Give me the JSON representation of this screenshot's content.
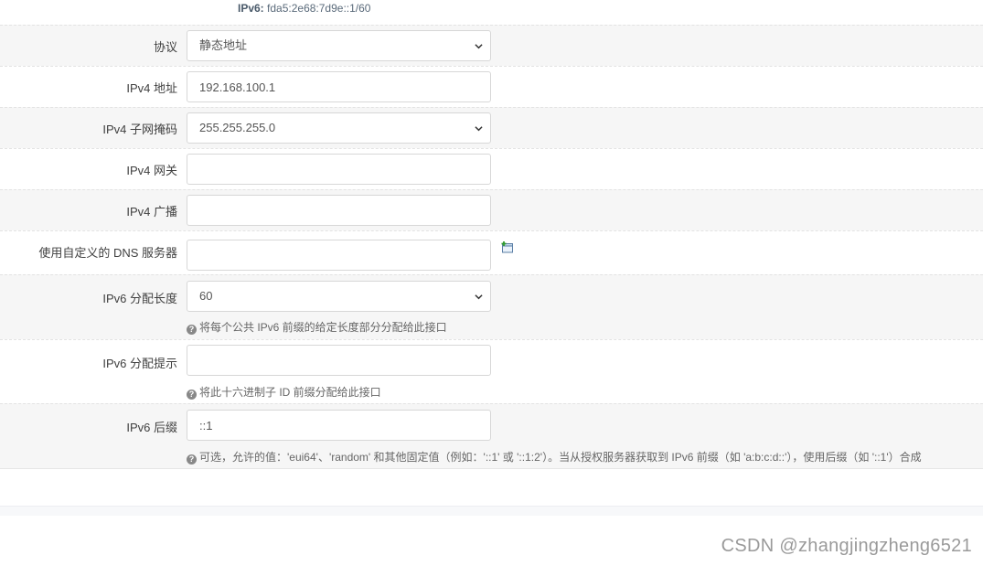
{
  "header": {
    "ipv6_label": "IPv6:",
    "ipv6_value": "fda5:2e68:7d9e::1/60"
  },
  "fields": {
    "protocol": {
      "label": "协议",
      "value": "静态地址"
    },
    "ipv4_address": {
      "label": "IPv4 地址",
      "value": "192.168.100.1"
    },
    "ipv4_netmask": {
      "label": "IPv4 子网掩码",
      "value": "255.255.255.0"
    },
    "ipv4_gateway": {
      "label": "IPv4 网关",
      "value": ""
    },
    "ipv4_broadcast": {
      "label": "IPv4 广播",
      "value": ""
    },
    "custom_dns": {
      "label": "使用自定义的 DNS 服务器",
      "value": ""
    },
    "ipv6_assign_length": {
      "label": "IPv6 分配长度",
      "value": "60",
      "hint": "将每个公共 IPv6 前缀的给定长度部分分配给此接口"
    },
    "ipv6_assign_hint": {
      "label": "IPv6 分配提示",
      "value": "",
      "hint": "将此十六进制子 ID 前缀分配给此接口"
    },
    "ipv6_suffix": {
      "label": "IPv6 后缀",
      "value": "::1",
      "hint": "可选，允许的值：'eui64'、'random' 和其他固定值（例如：'::1' 或 '::1:2'）。当从授权服务器获取到 IPv6 前缀（如 'a:b:c:d::'），使用后缀（如 '::1'）合成"
    }
  },
  "icons": {
    "add": "add-entry-icon",
    "help": "help-icon",
    "chevron": "chevron-down-icon"
  },
  "watermark": "CSDN @zhangjingzheng6521"
}
